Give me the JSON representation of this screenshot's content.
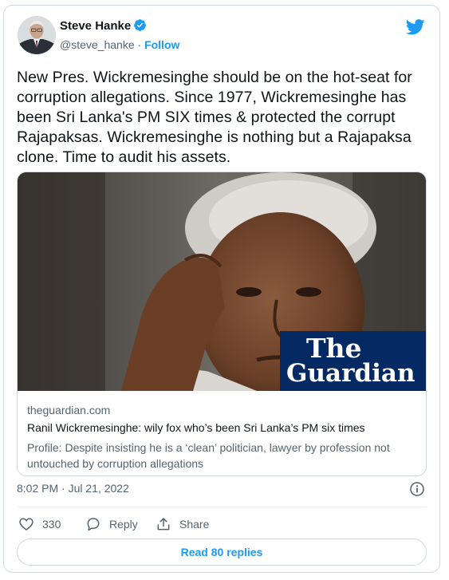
{
  "author": {
    "name": "Steve Hanke",
    "handle": "@steve_hanke",
    "separator": "·",
    "follow_label": "Follow"
  },
  "tweet": {
    "text": "New Pres. Wickremesinghe should be on the hot-seat for corruption allegations. Since 1977, Wickremesinghe has been Sri Lanka's PM SIX times & protected the corrupt Rajapaksas. Wickremesinghe is nothing but a Rajapaksa clone. Time to audit his assets.",
    "timestamp": "8:02 PM · Jul 21, 2022"
  },
  "link_card": {
    "logo_line1": "The",
    "logo_line2": "Guardian",
    "domain": "theguardian.com",
    "title": "Ranil Wickremesinghe: wily fox who’s been Sri Lanka’s PM six times",
    "description": "Profile: Despite insisting he is a ‘clean’ politician, lawyer by profession not untouched by corruption allegations"
  },
  "actions": {
    "like_count": "330",
    "reply_label": "Reply",
    "share_label": "Share"
  },
  "read_replies_label": "Read 80 replies",
  "icons": {
    "brand": "twitter-bird-icon",
    "verified": "verified-badge-icon",
    "info": "info-icon",
    "like": "heart-icon",
    "reply": "reply-bubble-icon",
    "share": "share-icon"
  },
  "colors": {
    "accent": "#1d9bf0",
    "guardian_blue": "#052962",
    "secondary_text": "#536471",
    "border": "#cfd9de"
  }
}
